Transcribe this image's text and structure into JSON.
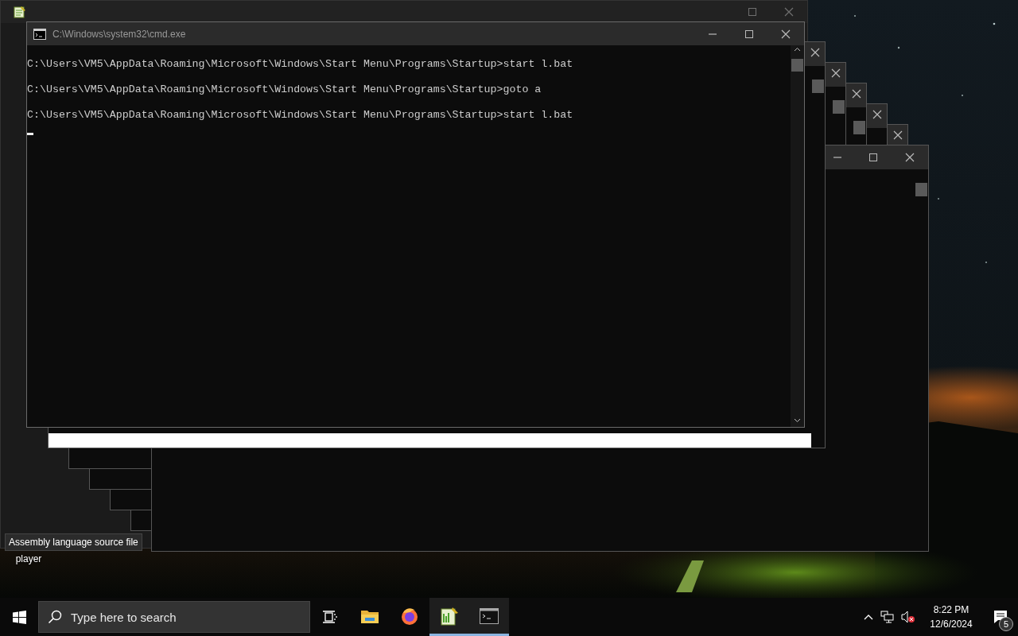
{
  "desktop": {
    "icons": [
      {
        "label": "player"
      }
    ],
    "tooltip": {
      "text": "Assembly language source file"
    }
  },
  "console": {
    "title": "C:\\Windows\\system32\\cmd.exe",
    "lines": [
      "C:\\Users\\VM5\\AppData\\Roaming\\Microsoft\\Windows\\Start Menu\\Programs\\Startup>start l.bat",
      "C:\\Users\\VM5\\AppData\\Roaming\\Microsoft\\Windows\\Start Menu\\Programs\\Startup>goto a",
      "C:\\Users\\VM5\\AppData\\Roaming\\Microsoft\\Windows\\Start Menu\\Programs\\Startup>start l.bat"
    ]
  },
  "taskbar": {
    "search": {
      "placeholder": "Type here to search"
    },
    "apps": [
      {
        "kind": "explorer",
        "active": false
      },
      {
        "kind": "firefox",
        "active": false
      },
      {
        "kind": "notepad",
        "active": true
      },
      {
        "kind": "console",
        "active": true
      }
    ],
    "tray": {
      "volume_muted": true,
      "time": "8:22 PM",
      "date": "12/6/2024",
      "notifications": "5"
    }
  }
}
